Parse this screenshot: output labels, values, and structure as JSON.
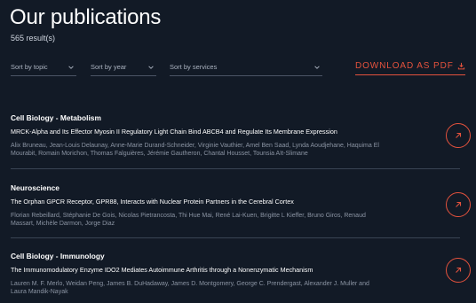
{
  "header": {
    "title": "Our publications",
    "result_count": "565 result(s)"
  },
  "filters": {
    "topic": "Sort by topic",
    "year": "Sort by year",
    "services": "Sort by services",
    "download_label": "DOWNLOAD AS PDF"
  },
  "publications": [
    {
      "category": "Cell Biology - Metabolism",
      "title": "MRCK-Alpha and Its Effector Myosin II Regulatory Light Chain Bind ABCB4 and Regulate Its Membrane Expression",
      "authors": "Alix Bruneau, Jean-Louis Delaunay, Anne-Marie Durand-Schneider, Virginie Vauthier, Amel Ben Saad, Lynda Aoudjehane, Haquima El Mourabit, Romain Morichon, Thomas Falguières, Jérémie Gautheron, Chantal Housset, Tounsia Aït-Slimane"
    },
    {
      "category": "Neuroscience",
      "title": "The Orphan GPCR Receptor, GPR88, Interacts with Nuclear Protein Partners in the Cerebral Cortex",
      "authors": "Florian Rebeillard, Stéphanie De Gois, Nicolas Pietrancosta, Thi Hue Mai, René Lai-Kuen, Brigitte L Kieffer, Bruno Giros, Renaud Massart, Michèle Darmon, Jorge Diaz"
    },
    {
      "category": "Cell Biology - Immunology",
      "title": "The Immunomodulatory Enzyme IDO2 Mediates Autoimmune Arthritis through a Nonenzymatic Mechanism",
      "authors": "Lauren M. F. Merlo, Weidan Peng, James B. DuHadaway, James D. Montgomery, George C. Prendergast, Alexander J. Muller and Laura Mandik-Nayak"
    }
  ],
  "colors": {
    "background": "#121a26",
    "accent": "#e4523d",
    "muted_text": "#8b94a3"
  },
  "icons": {
    "chevron": "chevron-down-icon",
    "download": "download-icon",
    "open": "arrow-up-right-icon"
  }
}
